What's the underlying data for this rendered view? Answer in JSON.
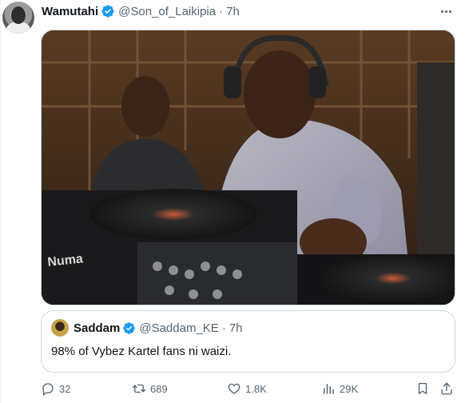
{
  "tweet": {
    "author": {
      "display_name": "Wamutahi",
      "handle": "@Son_of_Laikipia",
      "separator": "·",
      "time": "7h",
      "verified": true
    },
    "media": {
      "alt_icon": "photo"
    },
    "quoted_tweet": {
      "display_name": "Saddam",
      "handle": "@Saddam_KE",
      "separator": "·",
      "time": "7h",
      "verified": true,
      "text": "98% of Vybez Kartel fans ni waizi."
    },
    "actions": {
      "replies": "32",
      "retweets": "689",
      "likes": "1.8K",
      "views": "29K"
    }
  },
  "colors": {
    "verified": "#1d9bf0",
    "secondary_text": "#536471",
    "border": "#cfd9de"
  },
  "icons": {
    "more": "more-horizontal-icon",
    "reply": "reply-icon",
    "retweet": "retweet-icon",
    "like": "heart-icon",
    "views": "views-icon",
    "bookmark": "bookmark-icon",
    "share": "share-icon"
  }
}
